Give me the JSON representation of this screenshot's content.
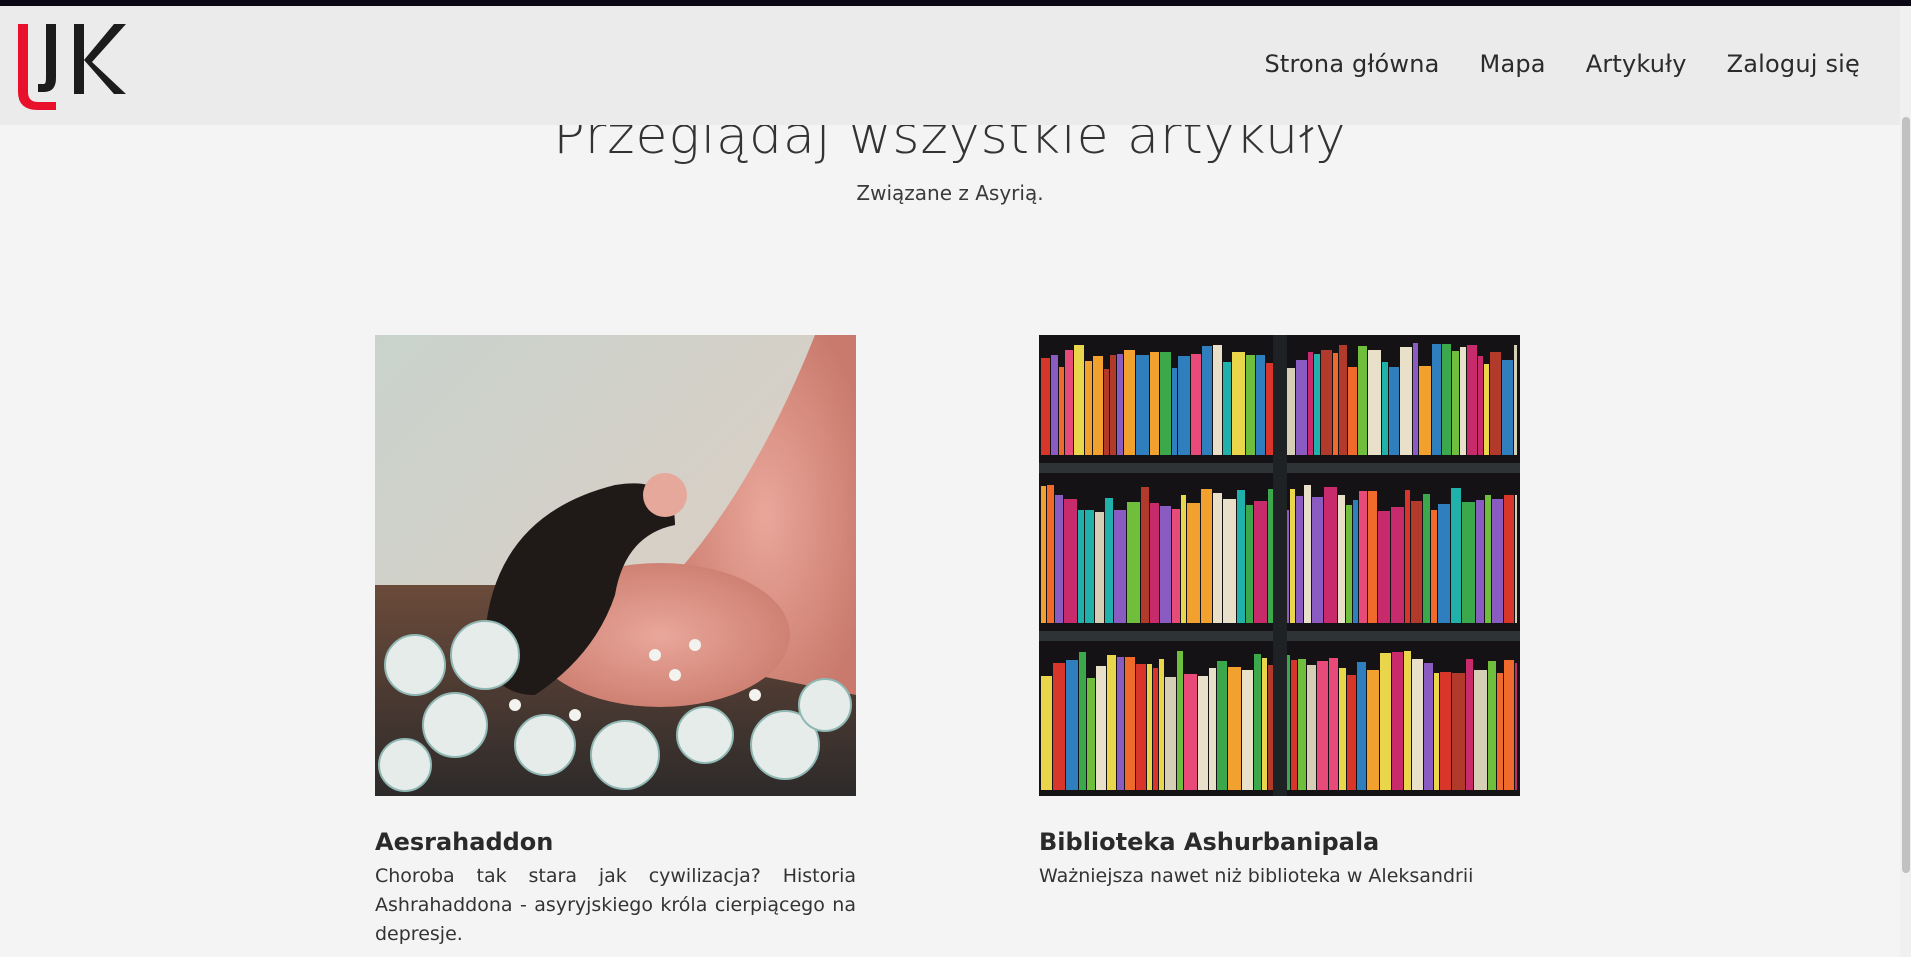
{
  "header": {
    "logo_alt": "UK",
    "nav": [
      {
        "label": "Strona główna"
      },
      {
        "label": "Mapa"
      },
      {
        "label": "Artykuły"
      },
      {
        "label": "Zaloguj się"
      }
    ]
  },
  "main": {
    "title": "Przeglądaj wszystkie artykuły",
    "subtitle": "Związane z Asyrią."
  },
  "articles": [
    {
      "title": "Aesrahaddon",
      "description": "Choroba tak stara jak cywilizacja? Historia Ashrahaddona - asyryjskiego króla cierpiącego na depresje.",
      "image": "man-lying-with-flowers"
    },
    {
      "title": "Biblioteka Ashurbanipala",
      "description": "Ważniejsza nawet niż biblioteka w Aleksandrii",
      "image": "colorful-bookshelf"
    }
  ],
  "colors": {
    "background": "#f4f4f4",
    "navbar": "#ebebeb",
    "logo_red": "#e8102a",
    "logo_dark": "#1c1c1c"
  }
}
